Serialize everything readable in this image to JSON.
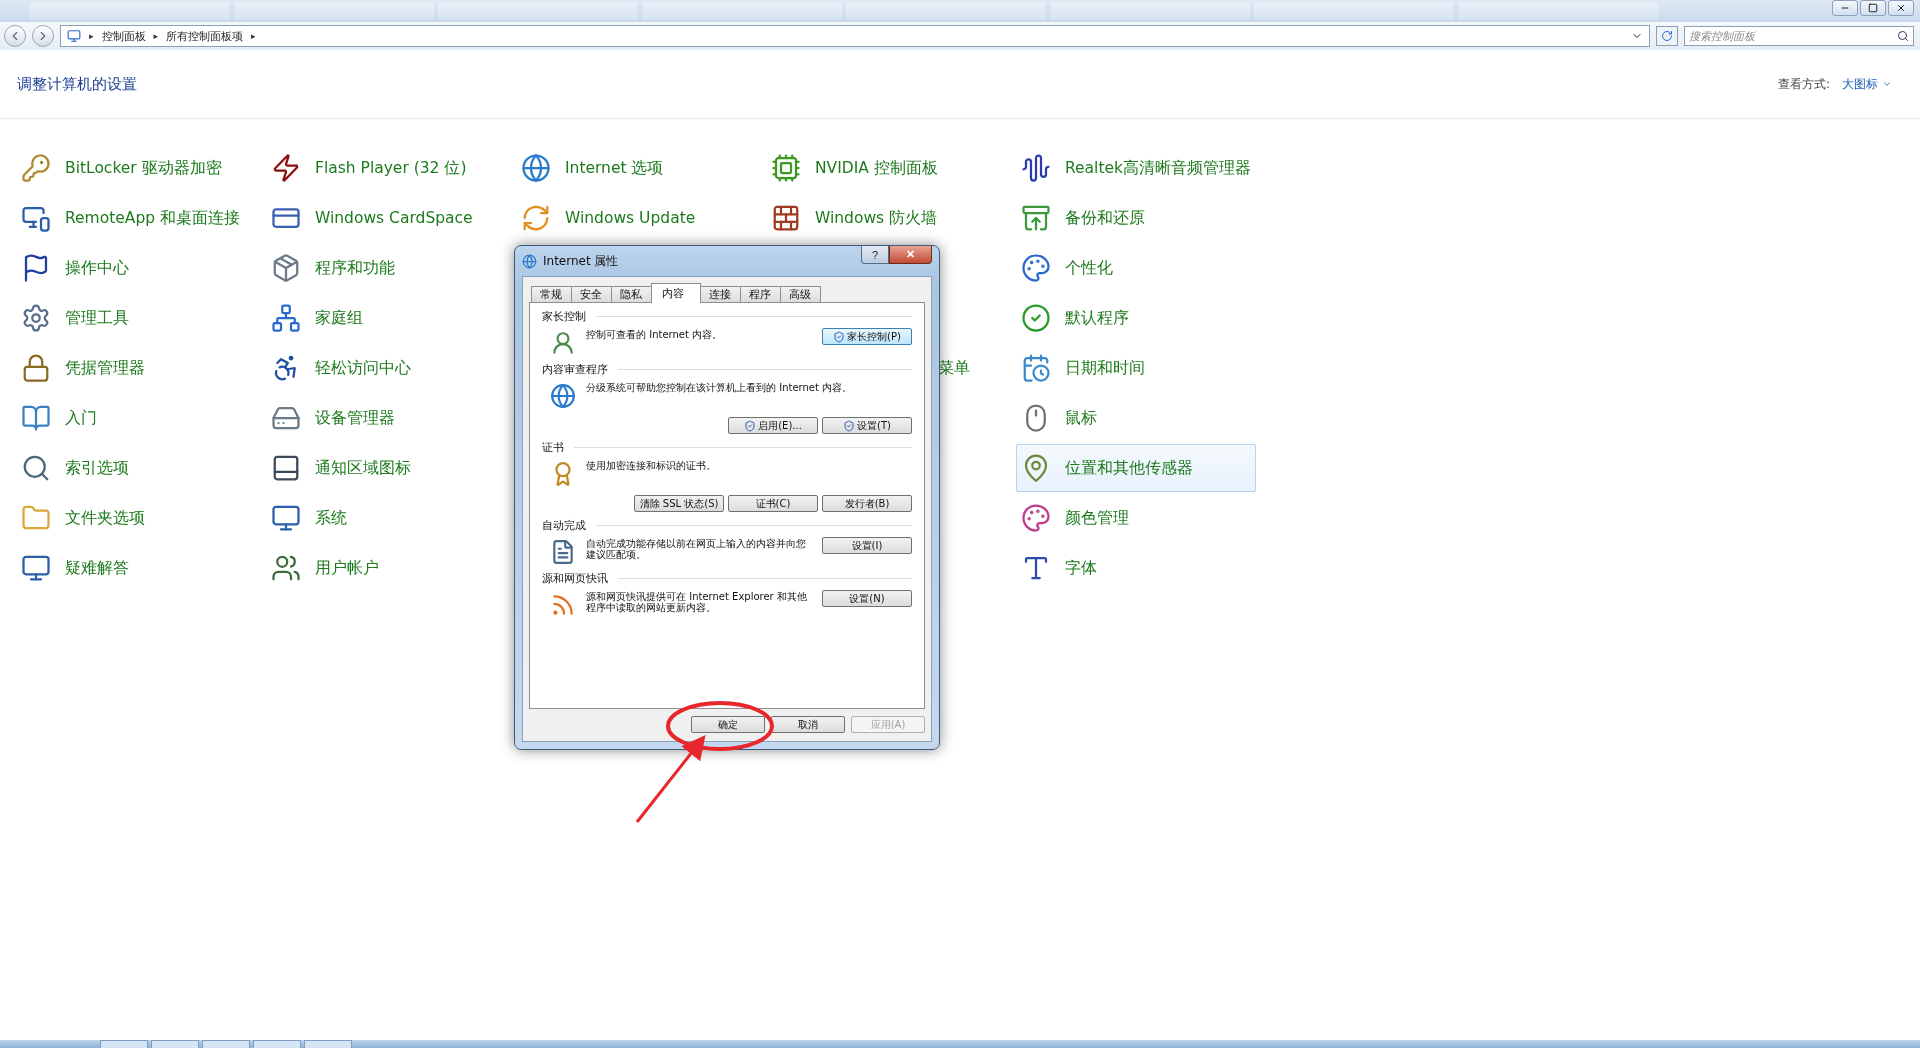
{
  "address_bar": {
    "breadcrumb": [
      "控制面板",
      "所有控制面板项"
    ],
    "separator": "▸",
    "search": {
      "placeholder": "搜索控制面板"
    }
  },
  "header": {
    "title": "调整计算机的设置",
    "view_label": "查看方式:",
    "view_value": "大图标"
  },
  "columns": [
    [
      {
        "label": "BitLocker 驱动器加密",
        "kind": "item",
        "highlighted": false
      },
      {
        "label": "RemoteApp 和桌面连接",
        "kind": "item",
        "highlighted": false
      },
      {
        "label": "操作中心",
        "kind": "item",
        "highlighted": false
      },
      {
        "label": "管理工具",
        "kind": "item",
        "highlighted": false
      },
      {
        "label": "凭据管理器",
        "kind": "item",
        "highlighted": false
      },
      {
        "label": "入门",
        "kind": "item",
        "highlighted": false
      },
      {
        "label": "索引选项",
        "kind": "item",
        "highlighted": false
      },
      {
        "label": "文件夹选项",
        "kind": "item",
        "highlighted": false
      },
      {
        "label": "疑难解答",
        "kind": "item",
        "highlighted": false
      }
    ],
    [
      {
        "label": "Flash Player (32 位)",
        "kind": "item",
        "highlighted": false
      },
      {
        "label": "Windows CardSpace",
        "kind": "item",
        "highlighted": false
      },
      {
        "label": "程序和功能",
        "kind": "item",
        "highlighted": false
      },
      {
        "label": "家庭组",
        "kind": "item",
        "highlighted": false
      },
      {
        "label": "轻松访问中心",
        "kind": "item",
        "highlighted": false
      },
      {
        "label": "设备管理器",
        "kind": "item",
        "highlighted": false
      },
      {
        "label": "通知区域图标",
        "kind": "item",
        "highlighted": false
      },
      {
        "label": "系统",
        "kind": "item",
        "highlighted": false
      },
      {
        "label": "用户帐户",
        "kind": "item",
        "highlighted": false
      }
    ],
    [
      {
        "label": "Internet 选项",
        "kind": "item",
        "highlighted": false
      },
      {
        "label": "Windows Update",
        "kind": "item",
        "highlighted": false
      }
    ],
    [
      {
        "label": "NVIDIA 控制面板",
        "kind": "item",
        "highlighted": false
      },
      {
        "label": "Windows 防火墙",
        "kind": "item",
        "highlighted": false
      },
      {
        "label": "菜单",
        "kind": "clipped"
      }
    ],
    [
      {
        "label": "Realtek高清晰音频管理器",
        "kind": "item",
        "highlighted": false
      },
      {
        "label": "备份和还原",
        "kind": "item",
        "highlighted": false
      },
      {
        "label": "个性化",
        "kind": "item",
        "highlighted": false
      },
      {
        "label": "默认程序",
        "kind": "item",
        "highlighted": false
      },
      {
        "label": "日期和时间",
        "kind": "item",
        "highlighted": false
      },
      {
        "label": "鼠标",
        "kind": "item",
        "highlighted": false
      },
      {
        "label": "位置和其他传感器",
        "kind": "item",
        "highlighted": true
      },
      {
        "label": "颜色管理",
        "kind": "item",
        "highlighted": false
      },
      {
        "label": "字体",
        "kind": "item",
        "highlighted": false
      }
    ]
  ],
  "dialog": {
    "title": "Internet 属性",
    "help": "?",
    "close": "✕",
    "tabs": [
      {
        "label": "常规",
        "selected": false
      },
      {
        "label": "安全",
        "selected": false
      },
      {
        "label": "隐私",
        "selected": false
      },
      {
        "label": "内容",
        "selected": true
      },
      {
        "label": "连接",
        "selected": false
      },
      {
        "label": "程序",
        "selected": false
      },
      {
        "label": "高级",
        "selected": false
      }
    ],
    "sections": [
      {
        "kind": "side",
        "title": "家长控制",
        "text": "控制可查看的 Internet 内容。",
        "buttons": [
          {
            "label": "家长控制(P)",
            "shield": true,
            "focused": true
          }
        ]
      },
      {
        "kind": "below",
        "title": "内容审查程序",
        "text": "分级系统可帮助您控制在该计算机上看到的 Internet 内容。",
        "buttons": [
          {
            "label": "启用(E)...",
            "shield": true,
            "focused": false
          },
          {
            "label": "设置(T)",
            "shield": true,
            "focused": false
          }
        ]
      },
      {
        "kind": "below",
        "title": "证书",
        "text": "使用加密连接和标识的证书。",
        "buttons": [
          {
            "label": "清除 SSL 状态(S)",
            "shield": false,
            "focused": false
          },
          {
            "label": "证书(C)",
            "shield": false,
            "focused": false
          },
          {
            "label": "发行者(B)",
            "shield": false,
            "focused": false
          }
        ]
      },
      {
        "kind": "side",
        "title": "自动完成",
        "text": "自动完成功能存储以前在网页上输入的内容并向您建议匹配项。",
        "buttons": [
          {
            "label": "设置(I)",
            "shield": false,
            "focused": false
          }
        ]
      },
      {
        "kind": "side",
        "title": "源和网页快讯",
        "text": "源和网页快讯提供可在 Internet Explorer 和其他程序中读取的网站更新内容。",
        "buttons": [
          {
            "label": "设置(N)",
            "shield": false,
            "focused": false
          }
        ]
      }
    ],
    "footer_buttons": [
      {
        "label": "确定",
        "disabled": false
      },
      {
        "label": "取消",
        "disabled": false
      },
      {
        "label": "应用(A)",
        "disabled": true
      }
    ]
  }
}
